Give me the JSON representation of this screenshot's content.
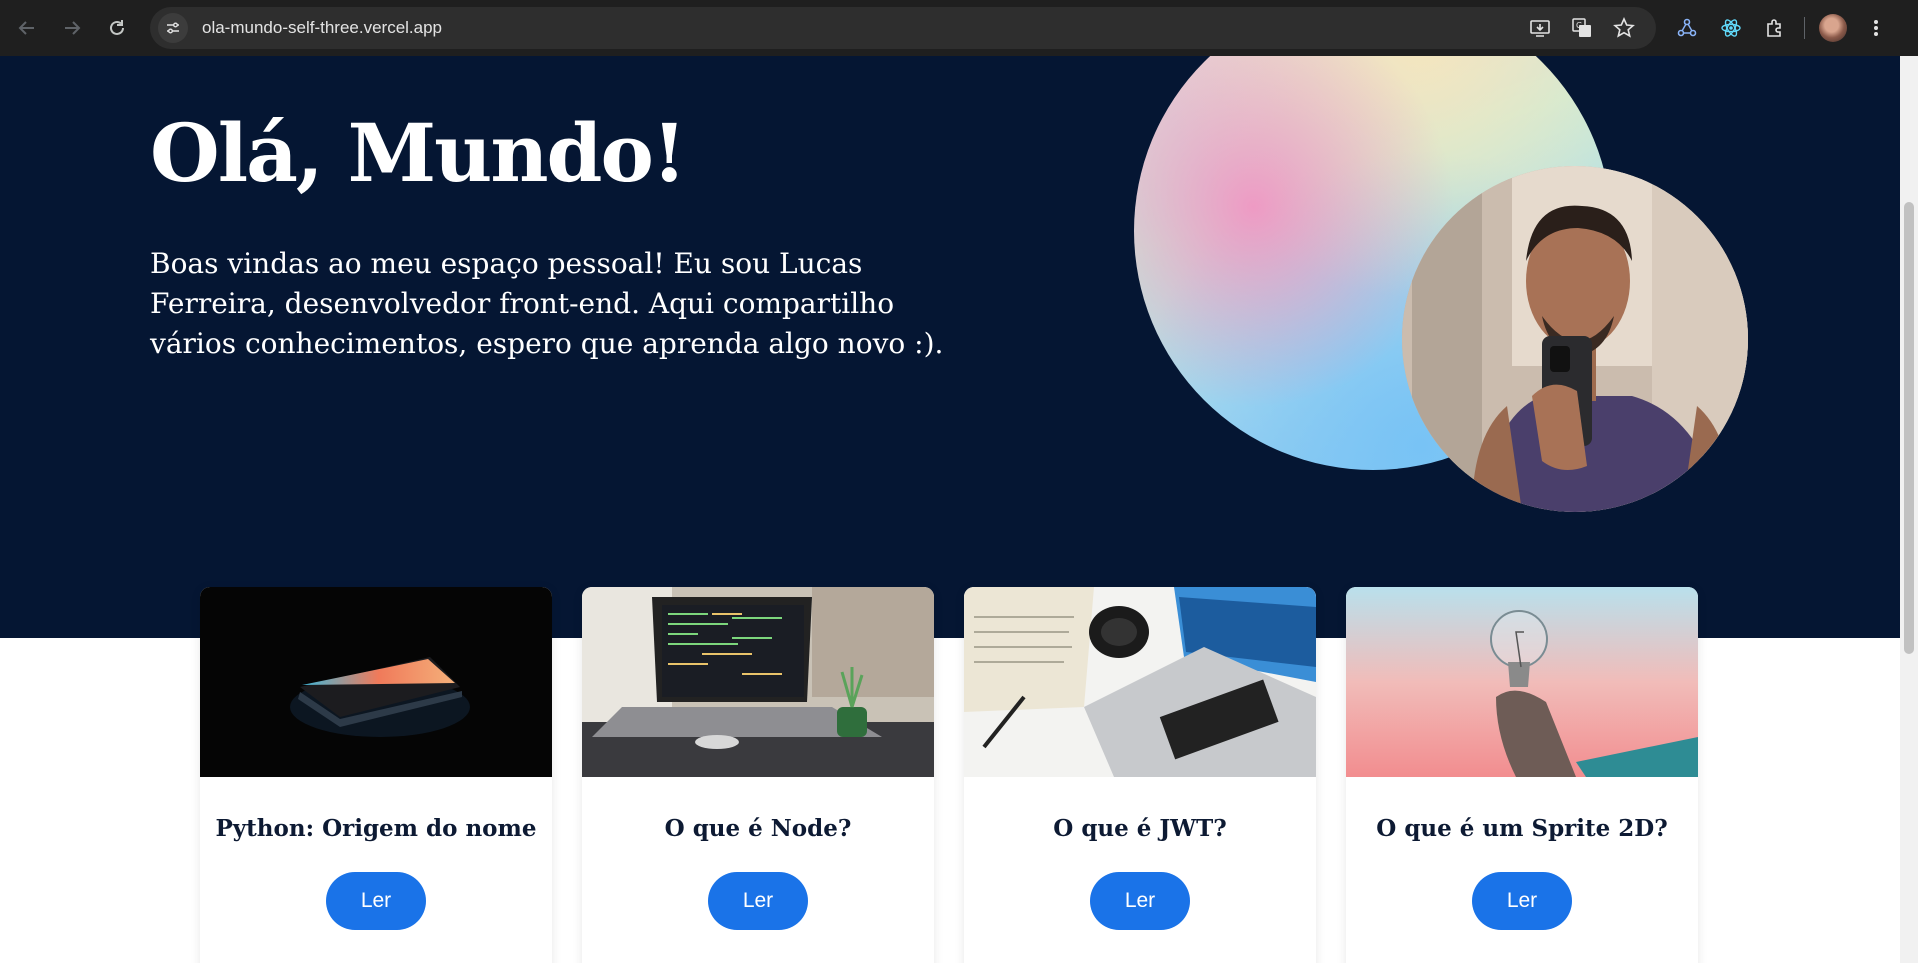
{
  "browser": {
    "url": "ola-mundo-self-three.vercel.app"
  },
  "hero": {
    "title": "Olá, Mundo!",
    "text": "Boas vindas ao meu espaço pessoal! Eu sou Lucas Ferreira, desenvolvedor front-end. Aqui compartilho vários conhecimentos, espero que aprenda algo novo :)."
  },
  "posts": [
    {
      "title": "Python: Origem do nome",
      "button": "Ler",
      "image": "dark-laptop-photo"
    },
    {
      "title": "O que é Node?",
      "button": "Ler",
      "image": "laptop-code-photo"
    },
    {
      "title": "O que é JWT?",
      "button": "Ler",
      "image": "desk-laptop-photo"
    },
    {
      "title": "O que é um Sprite 2D?",
      "button": "Ler",
      "image": "lightbulb-photo"
    }
  ],
  "colors": {
    "hero_bg": "#051633",
    "button": "#1a73e8",
    "chrome": "#1f1f1f"
  }
}
